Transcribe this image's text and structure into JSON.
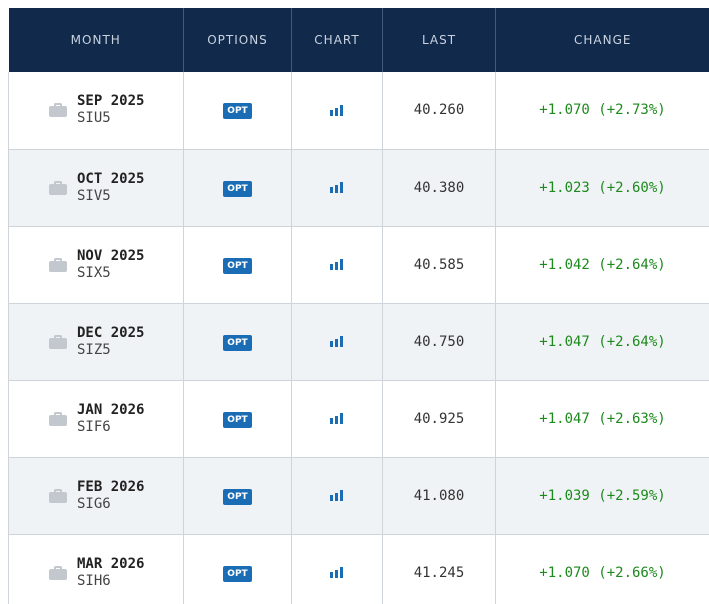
{
  "header": {
    "month": "MONTH",
    "options": "OPTIONS",
    "chart": "CHART",
    "last": "LAST",
    "change": "CHANGE"
  },
  "colors": {
    "header_bg": "#11294b",
    "opt_badge": "#1a6db5",
    "positive_change": "#1c8a1c",
    "alt_row": "#f0f3f6"
  },
  "rows": [
    {
      "month": "SEP 2025",
      "code": "SIU5",
      "opt": "OPT",
      "chart_icon": "bar-chart-icon",
      "last": "40.260",
      "change": "+1.070 (+2.73%)"
    },
    {
      "month": "OCT 2025",
      "code": "SIV5",
      "opt": "OPT",
      "chart_icon": "bar-chart-icon",
      "last": "40.380",
      "change": "+1.023 (+2.60%)"
    },
    {
      "month": "NOV 2025",
      "code": "SIX5",
      "opt": "OPT",
      "chart_icon": "bar-chart-icon",
      "last": "40.585",
      "change": "+1.042 (+2.64%)"
    },
    {
      "month": "DEC 2025",
      "code": "SIZ5",
      "opt": "OPT",
      "chart_icon": "bar-chart-icon",
      "last": "40.750",
      "change": "+1.047 (+2.64%)"
    },
    {
      "month": "JAN 2026",
      "code": "SIF6",
      "opt": "OPT",
      "chart_icon": "bar-chart-icon",
      "last": "40.925",
      "change": "+1.047 (+2.63%)"
    },
    {
      "month": "FEB 2026",
      "code": "SIG6",
      "opt": "OPT",
      "chart_icon": "bar-chart-icon",
      "last": "41.080",
      "change": "+1.039 (+2.59%)"
    },
    {
      "month": "MAR 2026",
      "code": "SIH6",
      "opt": "OPT",
      "chart_icon": "bar-chart-icon",
      "last": "41.245",
      "change": "+1.070 (+2.66%)"
    }
  ]
}
